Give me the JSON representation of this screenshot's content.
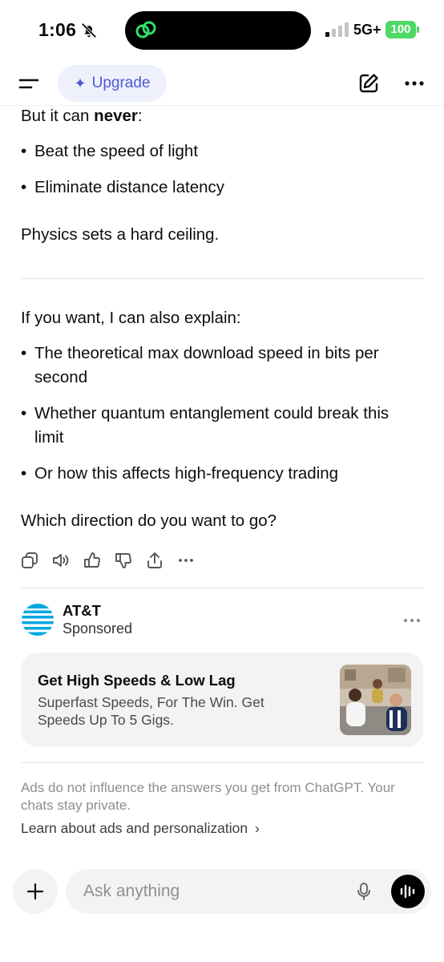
{
  "status_bar": {
    "time": "1:06",
    "network": "5G+",
    "battery": "100"
  },
  "header": {
    "upgrade_label": "Upgrade",
    "upgrade_icon": "sparkle-icon",
    "accent_color": "#4f5bd5"
  },
  "message": {
    "lead_prefix": "But it can ",
    "lead_bold": "never",
    "lead_suffix": ":",
    "limits": [
      "Beat the speed of light",
      "Eliminate distance latency"
    ],
    "conclusion": "Physics sets a hard ceiling.",
    "offer": "If you want, I can also explain:",
    "options": [
      "The theoretical max download speed in bits per second",
      "Whether quantum entanglement could break this limit",
      "Or how this affects high-frequency trading"
    ],
    "question": "Which direction do you want to go?"
  },
  "message_actions": [
    "copy-icon",
    "speaker-icon",
    "thumbs-up-icon",
    "thumbs-down-icon",
    "share-icon",
    "more-icon"
  ],
  "ad": {
    "advertiser": "AT&T",
    "sponsored_label": "Sponsored",
    "headline": "Get High Speeds & Low Lag",
    "description": "Superfast Speeds, For The Win. Get Speeds Up To 5 Gigs.",
    "brand_color": "#00a8e0"
  },
  "disclaimer": "Ads do not influence the answers you get from ChatGPT. Your chats stay private.",
  "learn_link": "Learn about ads and personalization",
  "composer": {
    "placeholder": "Ask anything"
  }
}
